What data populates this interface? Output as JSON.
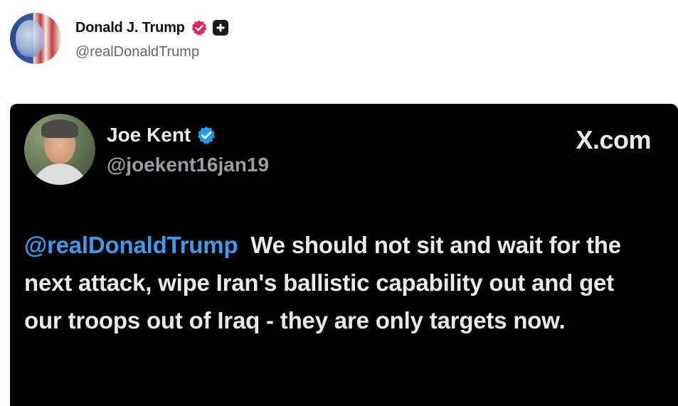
{
  "post": {
    "author_name": "Donald J. Trump",
    "author_handle": "@realDonaldTrump",
    "avatar_icon": "avatar-image",
    "verified_badge_color": "#e0245e"
  },
  "embed": {
    "author_name": "Joe Kent",
    "author_handle": "@joekent16jan19",
    "source": "X.com",
    "verified_badge_color": "#1d9bf0",
    "mention": "@realDonaldTrump",
    "text": "We should not sit and wait for the next attack, wipe Iran's ballistic capability out and get our troops out of Iraq - they are only targets now.",
    "mention_color": "#3d9be9",
    "background_color": "#000000"
  }
}
